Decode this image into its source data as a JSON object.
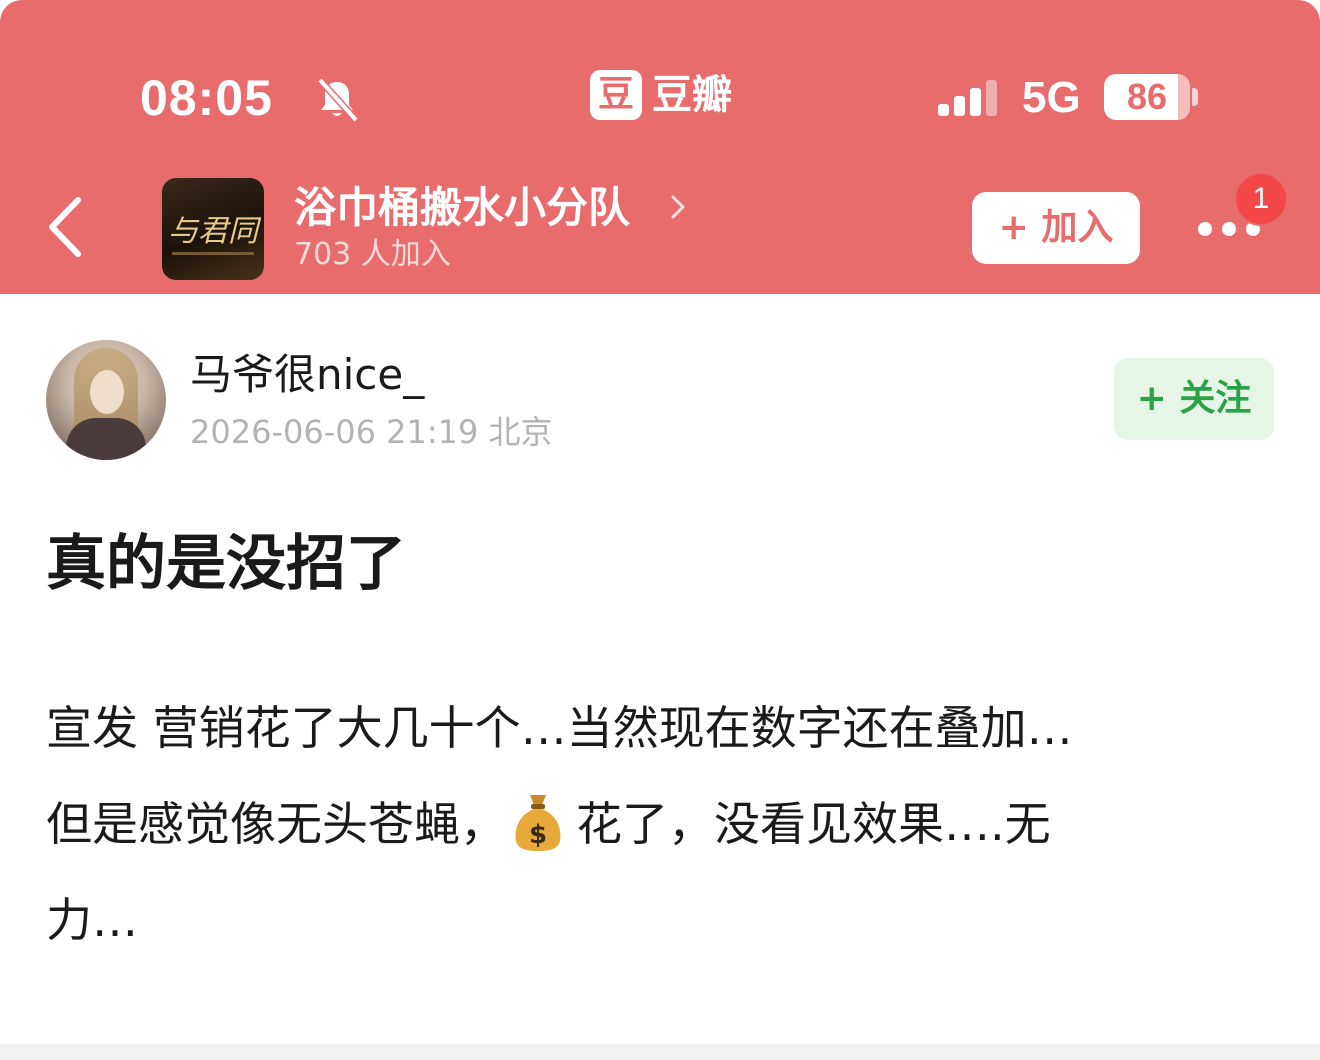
{
  "status_bar": {
    "time": "08:05",
    "app_icon_glyph": "豆",
    "app_name": "豆瓣",
    "network": "5G",
    "battery_level": "86",
    "battery_fraction": 0.86,
    "icons": [
      "bell-muted-icon",
      "signal-icon",
      "battery-icon"
    ]
  },
  "group": {
    "avatar_text": "与君同",
    "name": "浴巾桶搬水小分队",
    "members": "703 人加入",
    "join_label": "+ 加入",
    "notification_count": "1"
  },
  "post": {
    "author": "马爷很nice_",
    "meta": "2026-06-06 21:19  北京",
    "follow_label": "+ 关注",
    "title": "真的是没招了",
    "body": {
      "line1": "宣发 营销花了大几十个…当然现在数字还在叠加…",
      "line2_before_icon": "但是感觉像无头苍蝇，",
      "icon": "money-bag-icon",
      "line2_after_icon": "花了，没看见效果….无",
      "line3": "力…"
    }
  },
  "colors": {
    "header_bg": "#e86c6c",
    "follow_green": "#2ba245",
    "follow_bg": "#e5f5e6",
    "badge_red": "#f4474a"
  }
}
